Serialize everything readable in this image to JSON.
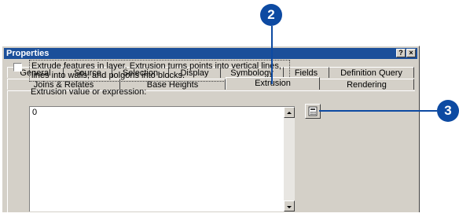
{
  "window": {
    "title": "Properties",
    "buttons": {
      "help": "?",
      "close": "×"
    }
  },
  "tabs": {
    "row1": [
      "General",
      "Source",
      "Selection",
      "Display",
      "Symbology",
      "Fields",
      "Definition Query"
    ],
    "row2": [
      "Joins & Relates",
      "Base Heights",
      "Extrusion",
      "Rendering"
    ],
    "active": "Extrusion"
  },
  "extrusion": {
    "checkbox_label": "Extrude features in layer.  Extrusion turns points into vertical lines, lines into walls, and polgons into blocks.",
    "checkbox_checked": false,
    "expression_label": "Extrusion value or expression:",
    "expression_value": "0"
  },
  "callouts": {
    "step2": "2",
    "step3": "3"
  },
  "colors": {
    "callout": "#0d4aa2",
    "titlebar": "#1b4f9a",
    "dialog": "#d4d0c8"
  }
}
